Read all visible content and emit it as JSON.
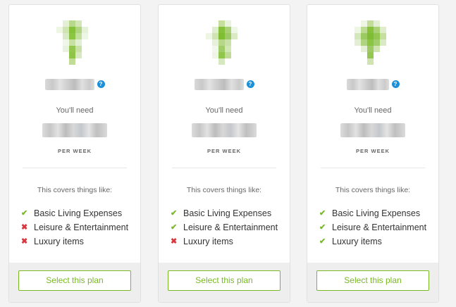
{
  "colors": {
    "accent": "#7ab826",
    "cross": "#d9363e",
    "help": "#1b8fd9"
  },
  "plans": [
    {
      "need_label": "You'll need",
      "per_label": "PER WEEK",
      "covers_label": "This covers things like:",
      "features": [
        {
          "label": "Basic Living Expenses",
          "included": true,
          "icon": "check-icon"
        },
        {
          "label": "Leisure & Entertainment",
          "included": false,
          "icon": "cross-icon"
        },
        {
          "label": "Luxury items",
          "included": false,
          "icon": "cross-icon"
        }
      ],
      "button_label": "Select this plan"
    },
    {
      "need_label": "You'll need",
      "per_label": "PER WEEK",
      "covers_label": "This covers things like:",
      "features": [
        {
          "label": "Basic Living Expenses",
          "included": true,
          "icon": "check-icon"
        },
        {
          "label": "Leisure & Entertainment",
          "included": true,
          "icon": "check-icon"
        },
        {
          "label": "Luxury items",
          "included": false,
          "icon": "cross-icon"
        }
      ],
      "button_label": "Select this plan"
    },
    {
      "need_label": "You'll need",
      "per_label": "PER WEEK",
      "covers_label": "This covers things like:",
      "features": [
        {
          "label": "Basic Living Expenses",
          "included": true,
          "icon": "check-icon"
        },
        {
          "label": "Leisure & Entertainment",
          "included": true,
          "icon": "check-icon"
        },
        {
          "label": "Luxury items",
          "included": true,
          "icon": "check-icon"
        }
      ],
      "button_label": "Select this plan"
    }
  ]
}
